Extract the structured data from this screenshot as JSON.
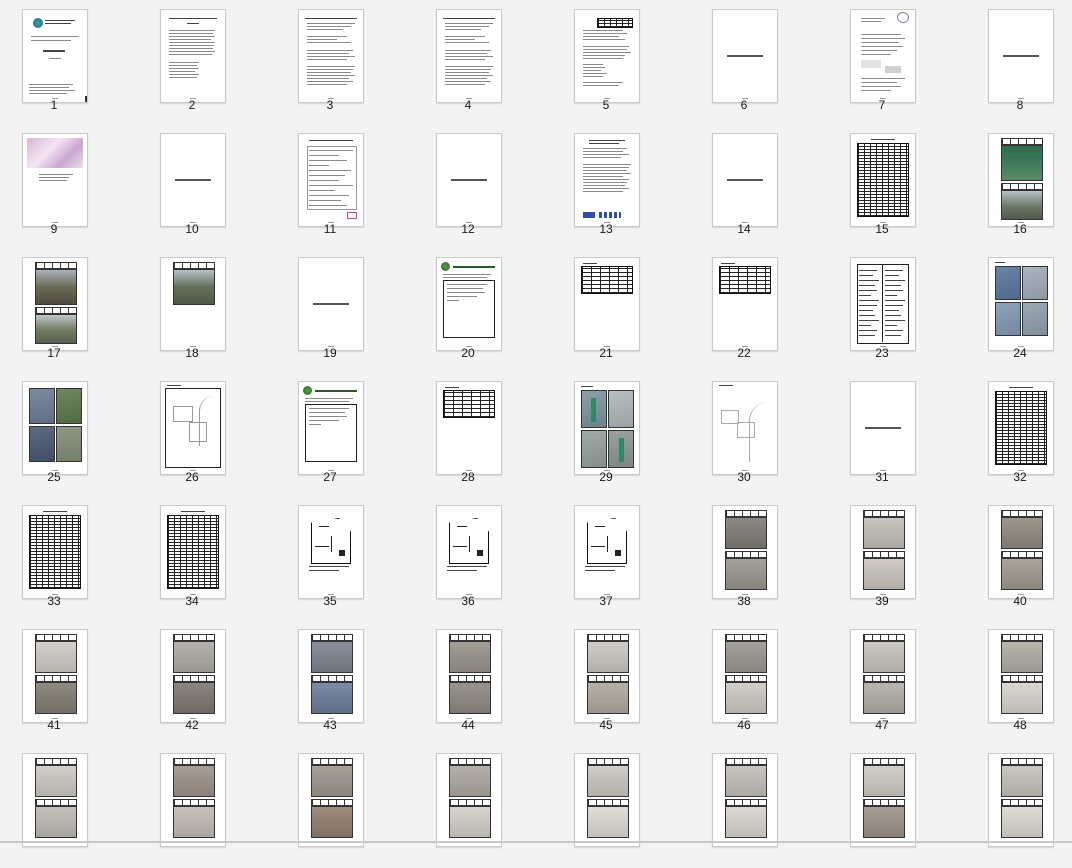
{
  "view": "page-thumbnails",
  "columns": 8,
  "thumbnails": [
    {
      "label": "1",
      "kind": "cover"
    },
    {
      "label": "2",
      "kind": "toc"
    },
    {
      "label": "3",
      "kind": "text"
    },
    {
      "label": "4",
      "kind": "text"
    },
    {
      "label": "5",
      "kind": "text-table"
    },
    {
      "label": "6",
      "kind": "divider"
    },
    {
      "label": "7",
      "kind": "letter"
    },
    {
      "label": "8",
      "kind": "divider"
    },
    {
      "label": "9",
      "kind": "certificate"
    },
    {
      "label": "10",
      "kind": "divider"
    },
    {
      "label": "11",
      "kind": "form"
    },
    {
      "label": "12",
      "kind": "divider"
    },
    {
      "label": "13",
      "kind": "letter-sign"
    },
    {
      "label": "14",
      "kind": "divider"
    },
    {
      "label": "15",
      "kind": "dense-table"
    },
    {
      "label": "16",
      "kind": "photo-green"
    },
    {
      "label": "17",
      "kind": "photo-2-outdoor"
    },
    {
      "label": "18",
      "kind": "photo-1-outdoor"
    },
    {
      "label": "19",
      "kind": "divider"
    },
    {
      "label": "20",
      "kind": "company-box"
    },
    {
      "label": "21",
      "kind": "small-table"
    },
    {
      "label": "22",
      "kind": "small-table"
    },
    {
      "label": "23",
      "kind": "spec-table"
    },
    {
      "label": "24",
      "kind": "photo-4-blue"
    },
    {
      "label": "25",
      "kind": "photo-4-outdoor"
    },
    {
      "label": "26",
      "kind": "map-frame"
    },
    {
      "label": "27",
      "kind": "company-box"
    },
    {
      "label": "28",
      "kind": "small-table"
    },
    {
      "label": "29",
      "kind": "photo-4-indoor"
    },
    {
      "label": "30",
      "kind": "map"
    },
    {
      "label": "31",
      "kind": "divider"
    },
    {
      "label": "32",
      "kind": "dense-table"
    },
    {
      "label": "33",
      "kind": "dense-table"
    },
    {
      "label": "34",
      "kind": "dense-table"
    },
    {
      "label": "35",
      "kind": "floorplan"
    },
    {
      "label": "36",
      "kind": "floorplan"
    },
    {
      "label": "37",
      "kind": "floorplan"
    },
    {
      "label": "38",
      "kind": "photo-2",
      "top": "#8d8a86",
      "bot": "#a4a09a"
    },
    {
      "label": "39",
      "kind": "photo-2",
      "top": "#c8c4bf",
      "bot": "#cfcac4"
    },
    {
      "label": "40",
      "kind": "photo-2",
      "top": "#9a958d",
      "bot": "#a8a39b"
    },
    {
      "label": "41",
      "kind": "photo-2",
      "top": "#d3d0cc",
      "bot": "#8f8a82"
    },
    {
      "label": "42",
      "kind": "photo-2",
      "top": "#b6b2ad",
      "bot": "#8a857e"
    },
    {
      "label": "43",
      "kind": "photo-2",
      "top": "#8a8f99",
      "bot": "#7d8aa3"
    },
    {
      "label": "44",
      "kind": "photo-2",
      "top": "#a29e97",
      "bot": "#99948d"
    },
    {
      "label": "45",
      "kind": "photo-2",
      "top": "#cfcbc6",
      "bot": "#b7b1a8"
    },
    {
      "label": "46",
      "kind": "photo-2",
      "top": "#a4a09b",
      "bot": "#d1ceca"
    },
    {
      "label": "47",
      "kind": "photo-2",
      "top": "#cdc9c4",
      "bot": "#b9b5b0"
    },
    {
      "label": "48",
      "kind": "photo-2",
      "top": "#b8b4ae",
      "bot": "#dad7d3"
    },
    {
      "label": "",
      "kind": "photo-2-partial",
      "top": "#d1ceca",
      "bot": "#c4c0bb"
    },
    {
      "label": "",
      "kind": "photo-2-partial",
      "top": "#a79c96",
      "bot": "#c7c2bc"
    },
    {
      "label": "",
      "kind": "photo-2-partial",
      "top": "#a8a19a",
      "bot": "#9c8c80"
    },
    {
      "label": "",
      "kind": "photo-2-partial",
      "top": "#b5b0aa",
      "bot": "#d6d3cf"
    },
    {
      "label": "",
      "kind": "photo-2-partial",
      "top": "#cfcbc6",
      "bot": "#e0ddd9"
    },
    {
      "label": "",
      "kind": "photo-2-partial",
      "top": "#c9c5c0",
      "bot": "#dcd9d5"
    },
    {
      "label": "",
      "kind": "photo-2-partial",
      "top": "#d2cec9",
      "bot": "#a79d94"
    },
    {
      "label": "",
      "kind": "photo-2-partial",
      "top": "#cac6c1",
      "bot": "#dedad6"
    }
  ]
}
